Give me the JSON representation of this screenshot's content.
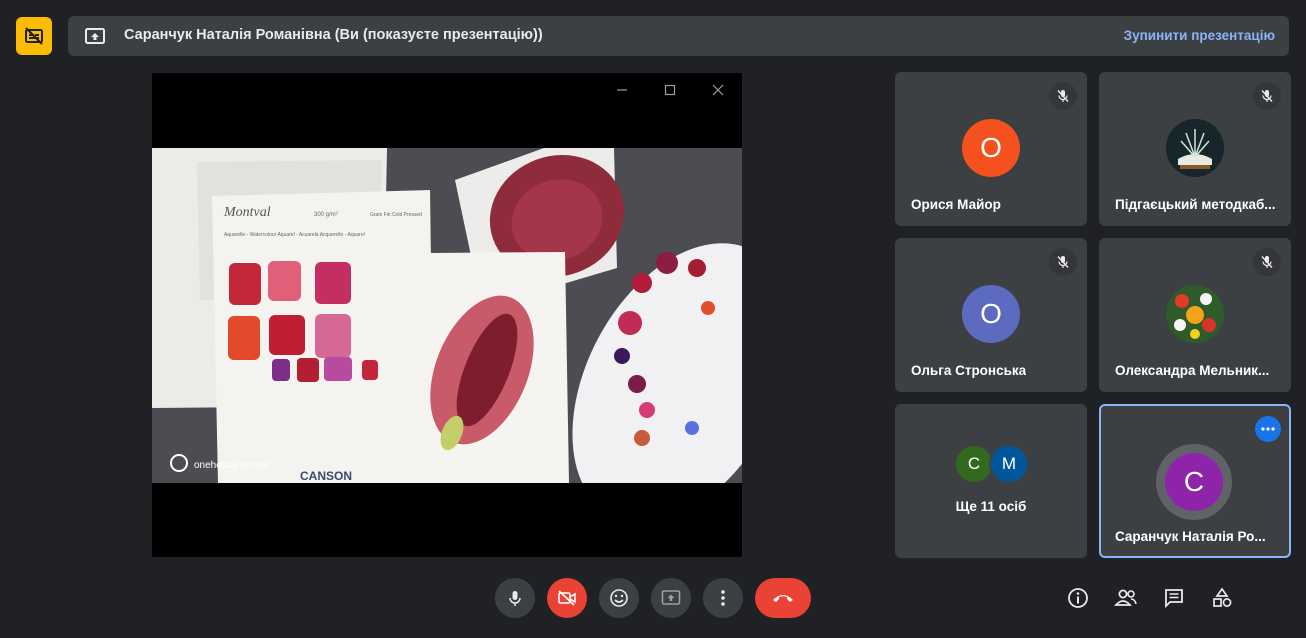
{
  "header": {
    "presenter_text": "Саранчук Наталія Романівна (Ви (показуєте презентацію))",
    "stop_presenting": "Зупинити презентацію"
  },
  "slide": {
    "brand_text": "onehobby.school",
    "paper_title": "Montval",
    "paper_weight": "300 g/m²",
    "paper_type": "Grain Fin\nCold Pressed",
    "paper_lines": "Aquarelle - Watercolour\nAquarel - Acuarela\nAcquerello - Aquarel",
    "paper_brand": "CANSON"
  },
  "participants": [
    {
      "name": "Орися Майор",
      "initial": "О",
      "color": "#f4511e"
    },
    {
      "name": "Підгаєцький методкаб...",
      "initial": "",
      "color": "#1b2a2a"
    },
    {
      "name": "Ольга Стронська",
      "initial": "О",
      "color": "#5c6bc0"
    },
    {
      "name": "Олександра Мельник...",
      "initial": "",
      "color": "#2e5e2e"
    },
    {
      "name": "Саранчук Наталія Ро...",
      "initial": "С",
      "color": "#8e24aa"
    }
  ],
  "others": {
    "label": "Ще 11 осіб",
    "avatar1": "С",
    "avatar1_color": "#33691e",
    "avatar2": "М",
    "avatar2_color": "#01579b"
  },
  "colors": {
    "accent_yellow": "#fbbc04",
    "link_blue": "#8ab4f8",
    "end_call_red": "#ea4335",
    "active_tile_border": "#8ab4f8"
  },
  "icons": {
    "caption": "captions-off-icon",
    "present": "present-to-all-icon",
    "mic": "mic-icon",
    "camera": "camera-off-icon",
    "reaction": "emoji-icon",
    "present_btn": "present-to-all-icon",
    "more": "more-vert-icon",
    "hangup": "call-end-icon",
    "info": "info-icon",
    "people": "people-icon",
    "chat": "chat-icon",
    "activities": "activities-icon"
  }
}
